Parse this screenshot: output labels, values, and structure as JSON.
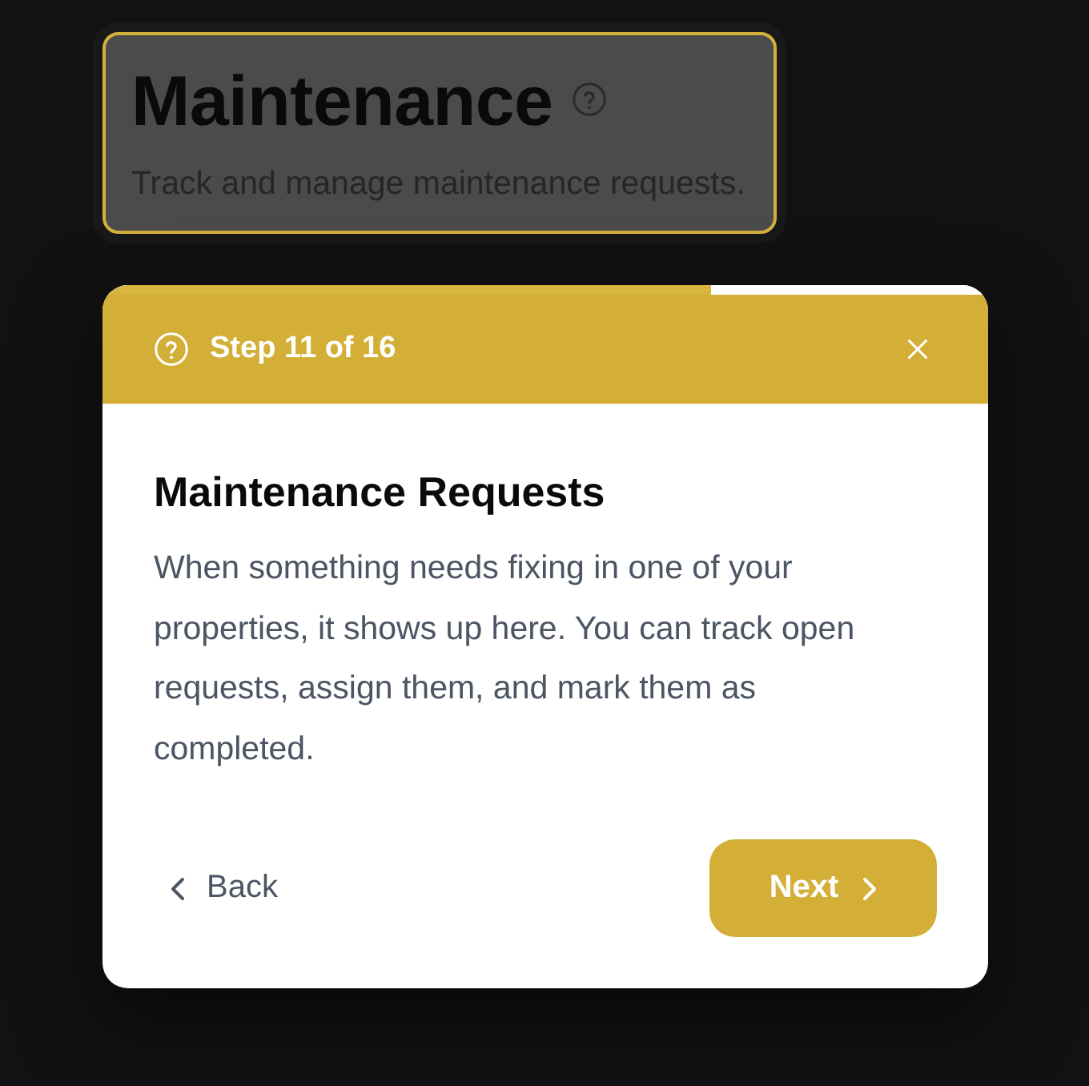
{
  "page_header": {
    "title": "Maintenance",
    "subtitle": "Track and manage maintenance requests.",
    "highlighted": true
  },
  "tour": {
    "progress": {
      "level": 0.6875
    },
    "step_label": "Step 11 of 16",
    "title": "Maintenance Requests",
    "body": "When something needs fixing in one of your properties, it shows up here. You can track open requests, assign them, and mark them as completed.",
    "buttons": [
      {
        "kind": "back",
        "label": "Back"
      },
      {
        "kind": "next",
        "label": "Next"
      }
    ]
  }
}
